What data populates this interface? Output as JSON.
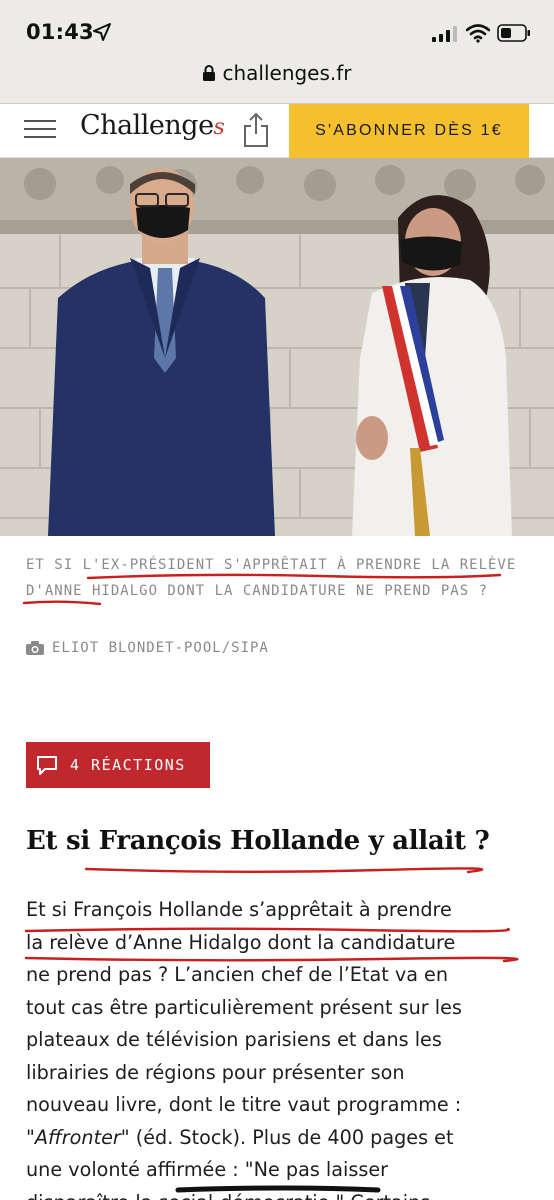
{
  "status_bar": {
    "time": "01:43",
    "url": "challenges.fr"
  },
  "site_header": {
    "logo_main": "Challenge",
    "logo_suffix": "s",
    "subscribe_label": "S'ABONNER DÈS 1€"
  },
  "hero": {
    "caption": "ET SI L'EX-PRÉSIDENT S'APPRÊTAIT À PRENDRE LA RELÈVE D'ANNE HIDALGO DONT LA CANDIDATURE NE PREND PAS ?",
    "credit": "ELIOT BLONDET-POOL/SIPA"
  },
  "reactions": {
    "label": "4 RÉACTIONS"
  },
  "article": {
    "headline": "Et si François Hollande y allait ?",
    "body_lines": [
      "Et si François Hollande s’apprêtait à prendre",
      "la relève d’Anne Hidalgo dont la candidature",
      "ne prend pas ? L’ancien chef de l’Etat va en",
      "tout cas être particulièrement présent sur les",
      "plateaux de télévision parisiens et dans les",
      "librairies de régions pour présenter son",
      "nouveau livre, dont le titre vaut programme :"
    ],
    "line8_italic": "\"Affronter\"",
    "line8_rest": " (éd. Stock). Plus de 400 pages et",
    "line9": "une volonté affirmée : \"Ne pas laisser",
    "line10": "disparaître la social-démocratie.\" Certains"
  },
  "colors": {
    "subscribe_bg": "#f4c02d",
    "reactions_bg": "#c0282d",
    "annotation_red": "#c8201e"
  }
}
